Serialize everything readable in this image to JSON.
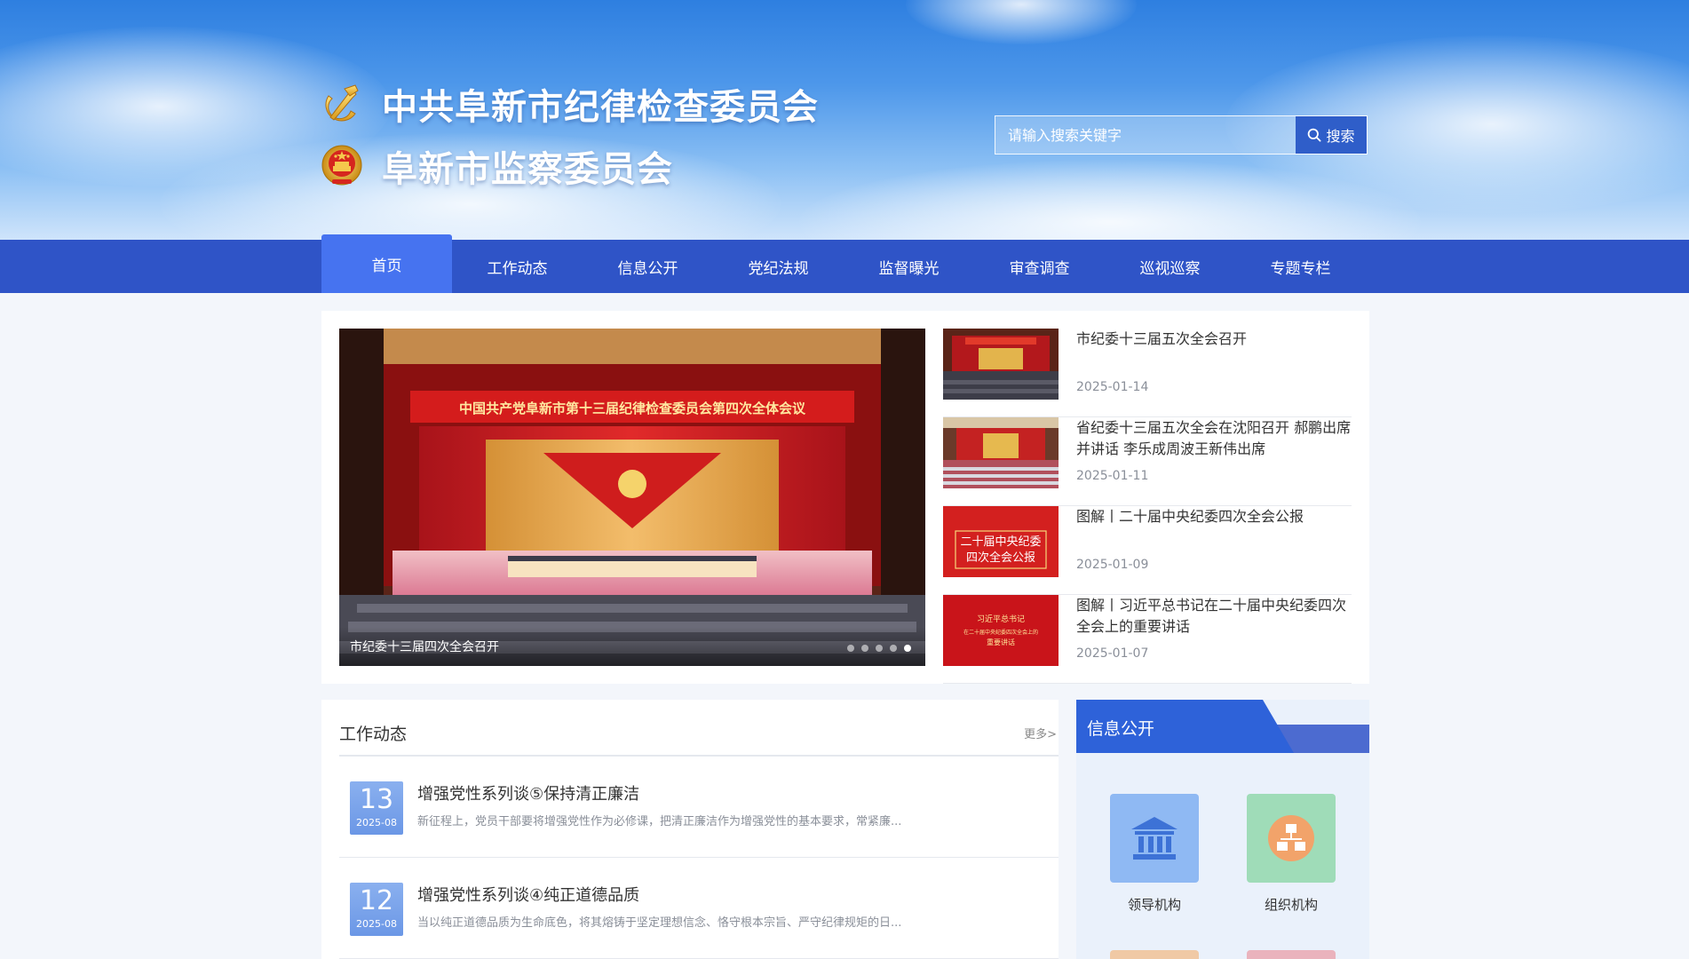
{
  "header": {
    "title_primary": "中共阜新市纪律检查委员会",
    "title_secondary": "阜新市监察委员会",
    "icons": [
      "party-emblem-icon",
      "national-emblem-icon"
    ]
  },
  "search": {
    "placeholder": "请输入搜索关键字",
    "button_label": "搜索",
    "icon": "search-icon"
  },
  "nav": {
    "items": [
      {
        "label": "首页",
        "active": true
      },
      {
        "label": "工作动态"
      },
      {
        "label": "信息公开"
      },
      {
        "label": "党纪法规"
      },
      {
        "label": "监督曝光"
      },
      {
        "label": "审查调查"
      },
      {
        "label": "巡视巡察"
      },
      {
        "label": "专题专栏"
      }
    ]
  },
  "slider": {
    "caption": "市纪委十三届四次全会召开",
    "banner_text": "中国共产党阜新市第十三届纪律检查委员会第四次全体会议",
    "dots": 5,
    "active_dot": 5
  },
  "news": [
    {
      "title": "市纪委十三届五次全会召开",
      "date": "2025-01-14"
    },
    {
      "title": "省纪委十三届五次全会在沈阳召开 郝鹏出席并讲话 李乐成周波王新伟出席",
      "date": "2025-01-11"
    },
    {
      "title": "图解丨二十届中央纪委四次全会公报",
      "date": "2025-01-09",
      "thumb_text": [
        "二十届中央纪委",
        "四次全会公报"
      ]
    },
    {
      "title": "图解丨习近平总书记在二十届中央纪委四次全会上的重要讲话",
      "date": "2025-01-07",
      "thumb_text": [
        "习近平总书记",
        "在二十届中央纪委四次全会上的",
        "重要讲话"
      ]
    }
  ],
  "work": {
    "title": "工作动态",
    "more": "更多>",
    "items": [
      {
        "day": "13",
        "ym": "2025-08",
        "title": "增强党性系列谈⑤保持清正廉洁",
        "summary": "新征程上，党员干部要将增强党性作为必修课，把清正廉洁作为增强党性的基本要求，常紧廉..."
      },
      {
        "day": "12",
        "ym": "2025-08",
        "title": "增强党性系列谈④纯正道德品质",
        "summary": "当以纯正道德品质为生命底色，将其熔铸于坚定理想信念、恪守根本宗旨、严守纪律规矩的日..."
      }
    ]
  },
  "info": {
    "title": "信息公开",
    "tiles": [
      {
        "label": "领导机构",
        "icon": "government-building-icon",
        "color": "#8fb9f3"
      },
      {
        "label": "组织机构",
        "icon": "org-structure-icon",
        "color": "#9fdcb8"
      }
    ]
  },
  "colors": {
    "nav_bg": "#2f54c7",
    "nav_active": "#4673f0",
    "accent_blue": "#2e62d9",
    "date_badge": "#7aa3ea"
  }
}
